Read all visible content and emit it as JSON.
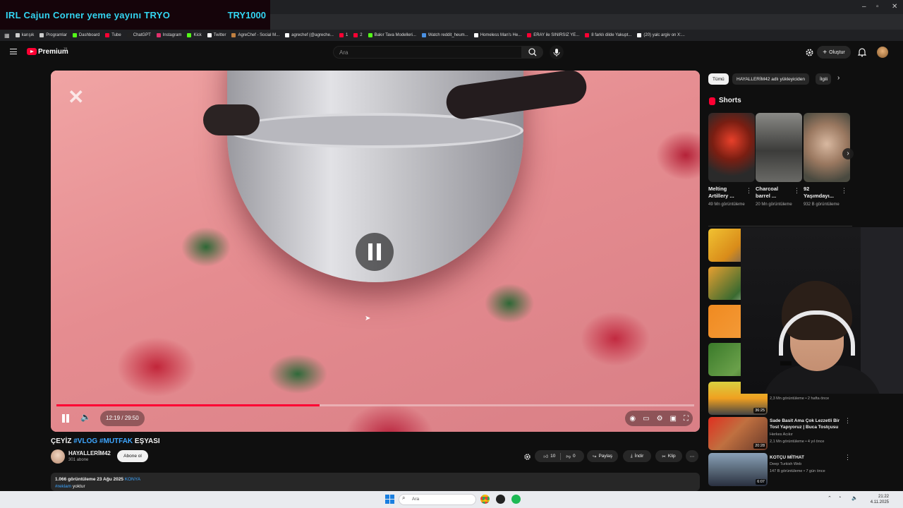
{
  "stream_overlay": {
    "title": "IRL Cajun Corner yeme yayını  TRYO",
    "right": "TRY1000"
  },
  "window_controls": {
    "minimize": "–",
    "restore": "▫",
    "close": "✕"
  },
  "bookmarks": [
    {
      "label": "karışık",
      "color": "#cccccc"
    },
    {
      "label": "Programlar",
      "color": "#cccccc"
    },
    {
      "label": "Dashboard",
      "color": "#53fc18"
    },
    {
      "label": "Tube",
      "color": "#ff0033"
    },
    {
      "label": "ChatGPT",
      "color": "#222222"
    },
    {
      "label": "Instagram",
      "color": "#e1306c"
    },
    {
      "label": "Kick",
      "color": "#53fc18"
    },
    {
      "label": "Twitter",
      "color": "#ffffff"
    },
    {
      "label": "AgreChef - Social M...",
      "color": "#c08040"
    },
    {
      "label": "agrechef (@agreche...",
      "color": "#ffffff"
    },
    {
      "label": "1",
      "color": "#ff0033"
    },
    {
      "label": "2",
      "color": "#ff0033"
    },
    {
      "label": "Bakır Tava Modelleri...",
      "color": "#53fc18"
    },
    {
      "label": "Watch reddit_heum...",
      "color": "#4a90e2"
    },
    {
      "label": "Homeless Man's He...",
      "color": "#ffffff"
    },
    {
      "label": "ERAY ile SINIRSIZ YE...",
      "color": "#ff0033"
    },
    {
      "label": "8 farklı dilde Yakupt...",
      "color": "#ff0033"
    },
    {
      "label": "(20) yalc argiv on X:...",
      "color": "#ffffff"
    }
  ],
  "header": {
    "logo_text": "Premium",
    "logo_region": "TR",
    "search_placeholder": "Ara",
    "create_label": "Oluştur",
    "menu_icon": "menu-icon",
    "search_icon": "search-icon",
    "mic_icon": "mic-icon",
    "bell_icon": "bell-icon"
  },
  "player": {
    "time": "12:19 / 29:50",
    "progress": 0.413,
    "watermark": "CapCut",
    "state": "paused"
  },
  "video": {
    "title_prefix": "ÇEYİZ ",
    "tag1": "#VLOG",
    "tag2": "#MUTFAK",
    "title_suffix": " EŞYASI",
    "channel": "HAYALLERİM42",
    "subscribers": "301 abone",
    "subscribe_label": "Abone ol",
    "likes": "10",
    "dislikes": "0",
    "share_label": "Paylaş",
    "download_label": "İndir",
    "clip_label": "Klip",
    "views": "1.066 görüntüleme",
    "date": "23 Ağu 2025",
    "location": "KONYA",
    "desc_tag": "#reklam",
    "desc_text": " yoktur"
  },
  "chips": [
    {
      "label": "Tümü",
      "active": true
    },
    {
      "label": "HAYALLERİM42 adlı yükleyiciden",
      "active": false
    },
    {
      "label": "İlgili",
      "active": false
    }
  ],
  "shorts": {
    "title": "Shorts",
    "items": [
      {
        "title": "Melting Artillery ...",
        "views": "49 Mn görüntüleme"
      },
      {
        "title": "Charcoal barrel ...",
        "views": "20 Mn görüntüleme"
      },
      {
        "title": "92 Yaşımdayı...",
        "views": "932 B görüntüleme"
      }
    ]
  },
  "recommendations": [
    {
      "title": "",
      "channel": "",
      "meta": "2,3 Mn görüntüleme • 2 hafta önce",
      "duration": "36:25"
    },
    {
      "title": "Sade Basit Ama Çok Lezzetli Bir Tost Yapıyoruz | Buca Tostçusu",
      "channel": "Herkes Acıkır",
      "meta": "2,1 Mn görüntüleme • 4 yıl önce",
      "duration": "20:28"
    },
    {
      "title": "KOTÇU MİTHAT",
      "channel": "Deep Turkish Web",
      "meta": "147 B görüntüleme • 7 gün önce",
      "duration": "6:07"
    }
  ],
  "taskbar": {
    "search_placeholder": "Ara",
    "time": "21:22",
    "date": "4.11.2025"
  }
}
